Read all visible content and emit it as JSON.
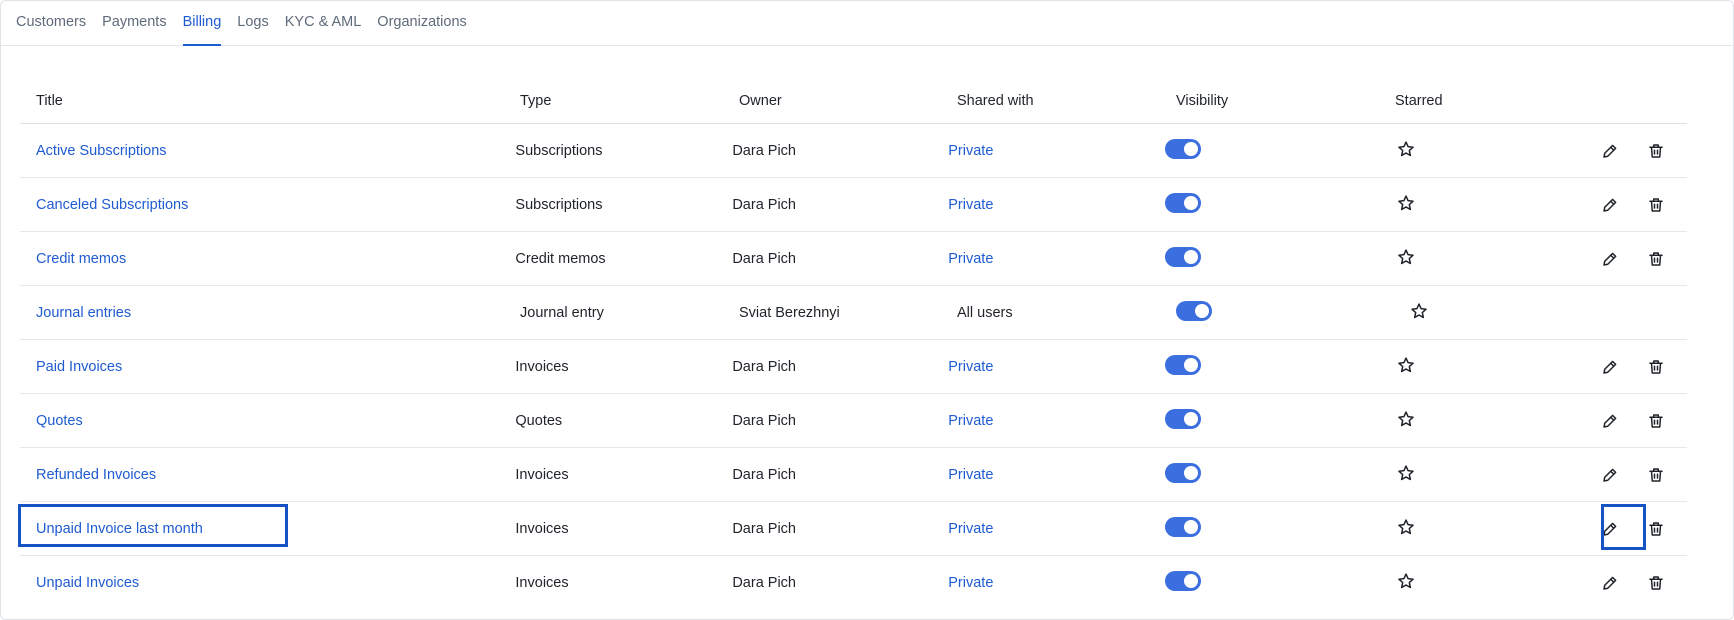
{
  "tabs": [
    {
      "label": "Customers",
      "active": false
    },
    {
      "label": "Payments",
      "active": false
    },
    {
      "label": "Billing",
      "active": true
    },
    {
      "label": "Logs",
      "active": false
    },
    {
      "label": "KYC & AML",
      "active": false
    },
    {
      "label": "Organizations",
      "active": false
    }
  ],
  "table": {
    "headers": {
      "title": "Title",
      "type": "Type",
      "owner": "Owner",
      "shared": "Shared with",
      "visibility": "Visibility",
      "starred": "Starred"
    },
    "rows": [
      {
        "title": "Active Subscriptions",
        "type": "Subscriptions",
        "owner": "Dara Pich",
        "shared": "Private",
        "visible": true,
        "starred": false,
        "editable": true
      },
      {
        "title": "Canceled Subscriptions",
        "type": "Subscriptions",
        "owner": "Dara Pich",
        "shared": "Private",
        "visible": true,
        "starred": false,
        "editable": true
      },
      {
        "title": "Credit memos",
        "type": "Credit memos",
        "owner": "Dara Pich",
        "shared": "Private",
        "visible": true,
        "starred": false,
        "editable": true
      },
      {
        "title": "Journal entries",
        "type": "Journal entry",
        "owner": "Sviat Berezhnyi",
        "shared": "All users",
        "visible": true,
        "starred": false,
        "editable": false
      },
      {
        "title": "Paid Invoices",
        "type": "Invoices",
        "owner": "Dara Pich",
        "shared": "Private",
        "visible": true,
        "starred": false,
        "editable": true
      },
      {
        "title": "Quotes",
        "type": "Quotes",
        "owner": "Dara Pich",
        "shared": "Private",
        "visible": true,
        "starred": false,
        "editable": true
      },
      {
        "title": "Refunded Invoices",
        "type": "Invoices",
        "owner": "Dara Pich",
        "shared": "Private",
        "visible": true,
        "starred": false,
        "editable": true
      },
      {
        "title": "Unpaid Invoice last month",
        "type": "Invoices",
        "owner": "Dara Pich",
        "shared": "Private",
        "visible": true,
        "starred": false,
        "editable": true,
        "highlighted": true
      },
      {
        "title": "Unpaid Invoices",
        "type": "Invoices",
        "owner": "Dara Pich",
        "shared": "Private",
        "visible": true,
        "starred": false,
        "editable": true
      }
    ]
  },
  "icons": {
    "star": "star-outline-icon",
    "edit": "pencil-icon",
    "delete": "trash-icon"
  },
  "colors": {
    "accent": "#1f5bd1",
    "toggle_on": "#3b6fe0",
    "highlight": "#1553c4",
    "muted_text": "#5f6b7a"
  }
}
